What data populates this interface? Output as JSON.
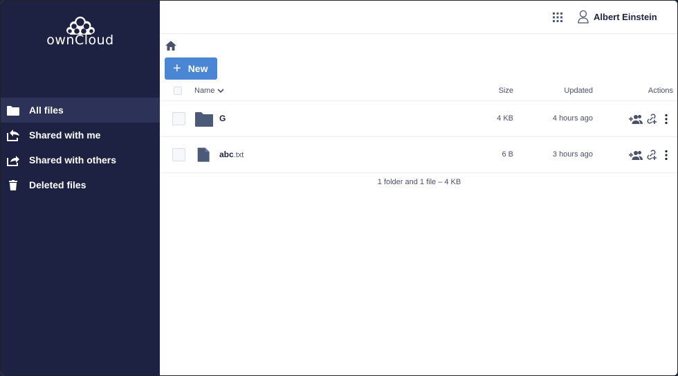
{
  "app": {
    "logo_text": "ownCloud"
  },
  "sidebar": {
    "items": [
      {
        "label": "All files",
        "icon": "folder-icon",
        "active": true
      },
      {
        "label": "Shared with me",
        "icon": "share-in-icon"
      },
      {
        "label": "Shared with others",
        "icon": "share-out-icon"
      },
      {
        "label": "Deleted files",
        "icon": "trash-icon"
      }
    ]
  },
  "header": {
    "user_name": "Albert Einstein"
  },
  "toolbar": {
    "new_label": "New"
  },
  "table": {
    "columns": {
      "name": "Name",
      "size": "Size",
      "updated": "Updated",
      "actions": "Actions"
    },
    "rows": [
      {
        "name": "G",
        "ext": "",
        "type": "folder",
        "size": "4 KB",
        "updated": "4 hours ago"
      },
      {
        "name": "abc",
        "ext": ".txt",
        "type": "file",
        "size": "6 B",
        "updated": "3 hours ago"
      }
    ],
    "summary": "1 folder and 1 file – 4 KB"
  },
  "colors": {
    "sidebar_bg": "#1d2242",
    "active_item_bg": "#2c3258",
    "primary_button": "#4a86d4",
    "icon_color": "#4a5a78"
  }
}
